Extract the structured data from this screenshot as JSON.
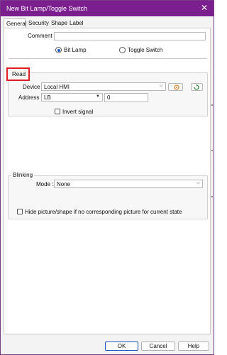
{
  "window": {
    "title": "New Bit Lamp/Toggle Switch",
    "close_icon": "close-icon"
  },
  "tabs": [
    {
      "label": "General",
      "active": true
    },
    {
      "label": "Security",
      "active": false
    },
    {
      "label": "Shape",
      "active": false
    },
    {
      "label": "Label",
      "active": false
    }
  ],
  "general": {
    "comment_label": "Comment :",
    "comment_value": "",
    "mode_options": [
      {
        "label": "Bit Lamp",
        "selected": true
      },
      {
        "label": "Toggle Switch",
        "selected": false
      }
    ]
  },
  "read": {
    "title": "Read",
    "device_label": "Device :",
    "device_value": "Local HMI",
    "address_label": "Address :",
    "address_type": "LB",
    "address_value": "0",
    "invert_label": "Invert signal",
    "invert_checked": false
  },
  "blinking": {
    "title": "Blinking",
    "mode_label": "Mode :",
    "mode_value": "None",
    "hide_label": "Hide picture/shape if no corresponding picture for current state",
    "hide_checked": false
  },
  "footer": {
    "ok_label": "OK",
    "cancel_label": "Cancel",
    "help_label": "Help"
  },
  "colors": {
    "titlebar": "#7b1f8f",
    "highlight": "#e02020",
    "accent": "#1a56c4"
  }
}
